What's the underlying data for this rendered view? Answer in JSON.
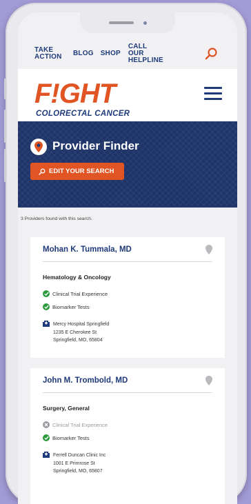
{
  "nav": {
    "take_action": "TAKE ACTION",
    "blog": "BLOG",
    "shop": "SHOP",
    "call_helpline": "CALL OUR HELPLINE"
  },
  "logo": {
    "wordmark": "F!GHT",
    "subtitle": "COLORECTAL CANCER"
  },
  "hero": {
    "title": "Provider Finder",
    "edit_button": "EDIT YOUR SEARCH"
  },
  "results": {
    "count_text": "3 Providers found with this search."
  },
  "providers": [
    {
      "name": "Mohan K. Tummala, MD",
      "specialty": "Hematology & Oncology",
      "features": [
        {
          "label": "Clinical Trial Experience",
          "available": true
        },
        {
          "label": "Biomarker Tests",
          "available": true
        }
      ],
      "location": {
        "name": "Mercy Hospital Springfield",
        "street": "1235 E Cherokee St",
        "city": "Springfield, MO, 65804"
      }
    },
    {
      "name": "John M. Trombold, MD",
      "specialty": "Surgery, General",
      "features": [
        {
          "label": "Clinical Trial Experience",
          "available": false
        },
        {
          "label": "Biomarker Tests",
          "available": true
        }
      ],
      "location": {
        "name": "Ferrell Duncan Clinic Inc",
        "street": "1001 E Primrose St",
        "city": "Springfield, MO, 65807"
      }
    }
  ],
  "colors": {
    "brand_orange": "#e15424",
    "brand_navy": "#1f3a7a",
    "hero_bg": "#1e3468",
    "check_green": "#2e9a3e",
    "check_gray": "#9a9aa0",
    "page_bg": "#a39bd6"
  }
}
